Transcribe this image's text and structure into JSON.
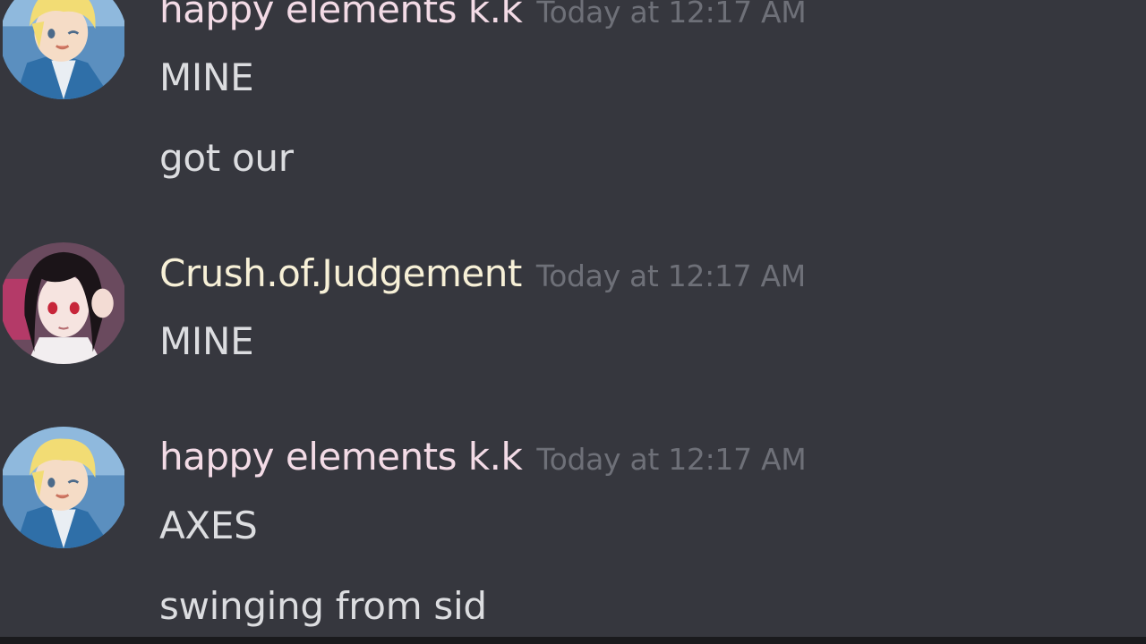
{
  "messages": [
    {
      "username": "happy elements k.k",
      "timestamp": "Today at 12:17 AM",
      "avatar_icon": "blonde-anime-boy-avatar",
      "lines": [
        "MINE",
        "got our"
      ]
    },
    {
      "username": "Crush.of.Judgement",
      "timestamp": "Today at 12:17 AM",
      "avatar_icon": "dark-haired-anime-girl-avatar",
      "lines": [
        "MINE"
      ]
    },
    {
      "username": "happy elements k.k",
      "timestamp": "Today at 12:17 AM",
      "avatar_icon": "blonde-anime-boy-avatar",
      "lines": [
        "AXES",
        "swinging from sid"
      ]
    }
  ],
  "colors": {
    "background": "#36373e",
    "username_pink": "#f3dbe6",
    "username_cream": "#f7f0d7",
    "timestamp": "#6e7078",
    "message_text": "#dcdde0"
  }
}
